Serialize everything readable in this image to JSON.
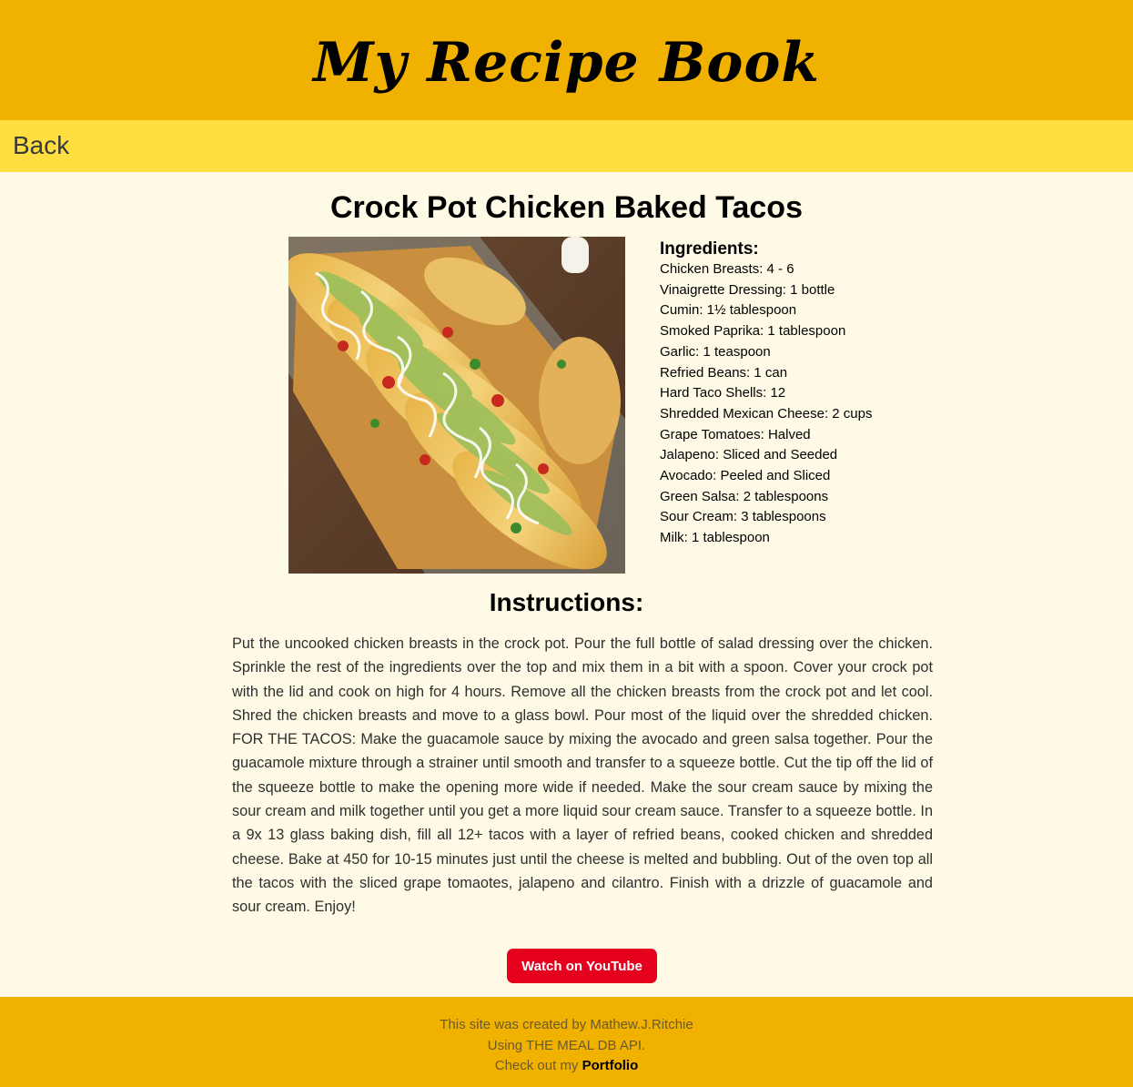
{
  "header": {
    "site_title": "My Recipe Book"
  },
  "nav": {
    "back_label": "Back"
  },
  "recipe": {
    "title": "Crock Pot Chicken Baked Tacos",
    "image_alt": "Crock Pot Chicken Baked Tacos",
    "ingredients_heading": "Ingredients:",
    "ingredients": [
      "Chicken Breasts: 4 - 6",
      "Vinaigrette Dressing: 1 bottle",
      "Cumin: 1½ tablespoon",
      "Smoked Paprika: 1 tablespoon",
      "Garlic: 1 teaspoon",
      "Refried Beans: 1 can",
      "Hard Taco Shells: 12",
      "Shredded Mexican Cheese: 2 cups",
      "Grape Tomatoes: Halved",
      "Jalapeno: Sliced and Seeded",
      "Avocado: Peeled and Sliced",
      "Green Salsa: 2 tablespoons",
      "Sour Cream: 3 tablespoons",
      "Milk: 1 tablespoon"
    ],
    "instructions_heading": "Instructions:",
    "instructions": "Put the uncooked chicken breasts in the crock pot. Pour the full bottle of salad dressing over the chicken. Sprinkle the rest of the ingredients over the top and mix them in a bit with a spoon. Cover your crock pot with the lid and cook on high for 4 hours. Remove all the chicken breasts from the crock pot and let cool. Shred the chicken breasts and move to a glass bowl. Pour most of the liquid over the shredded chicken. FOR THE TACOS: Make the guacamole sauce by mixing the avocado and green salsa together. Pour the guacamole mixture through a strainer until smooth and transfer to a squeeze bottle. Cut the tip off the lid of the squeeze bottle to make the opening more wide if needed. Make the sour cream sauce by mixing the sour cream and milk together until you get a more liquid sour cream sauce. Transfer to a squeeze bottle. In a 9x 13 glass baking dish, fill all 12+ tacos with a layer of refried beans, cooked chicken and shredded cheese. Bake at 450 for 10-15 minutes just until the cheese is melted and bubbling. Out of the oven top all the tacos with the sliced grape tomaotes, jalapeno and cilantro. Finish with a drizzle of guacamole and sour cream. Enjoy!",
    "youtube_label": "Watch on YouTube"
  },
  "footer": {
    "credit": "This site was created by Mathew.J.Ritchie",
    "api_note": "Using THE MEAL DB API.",
    "portfolio_prefix": "Check out my",
    "portfolio_link": "Portfolio"
  },
  "colors": {
    "header_bg": "#F0B100",
    "nav_bg": "#FFDF3F",
    "page_bg": "#FFFAE6",
    "youtube_red": "#E5001E"
  }
}
